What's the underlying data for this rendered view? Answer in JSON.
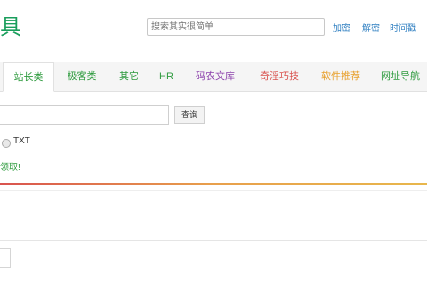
{
  "header": {
    "logo_fragment": "具",
    "search": {
      "placeholder": "搜索其实很简单",
      "links": [
        "加密",
        "解密",
        "时间戳"
      ]
    }
  },
  "nav": {
    "tabs": [
      {
        "label": "站长类",
        "color": "#2e9b3e",
        "active": true
      },
      {
        "label": "极客类",
        "color": "#2e9b3e",
        "active": false
      },
      {
        "label": "其它",
        "color": "#2e9b3e",
        "active": false
      },
      {
        "label": "HR",
        "color": "#2e9b3e",
        "active": false
      },
      {
        "label": "码农文库",
        "color": "#8e44ad",
        "active": false
      },
      {
        "label": "奇淫巧技",
        "color": "#d9534f",
        "active": false
      },
      {
        "label": "软件推荐",
        "color": "#e8a02c",
        "active": false
      },
      {
        "label": "网址导航",
        "color": "#2e9b3e",
        "active": false
      }
    ]
  },
  "query": {
    "input_value": "",
    "button_label": "查询"
  },
  "format_option": {
    "label": "TXT"
  },
  "notice": {
    "text": "领取!"
  },
  "colors": {
    "brand_green": "#1a9e5c",
    "link_blue": "#2f7fc1",
    "bar_gradient": [
      "#d9534f",
      "#e8a04c",
      "#e8b74c"
    ]
  }
}
